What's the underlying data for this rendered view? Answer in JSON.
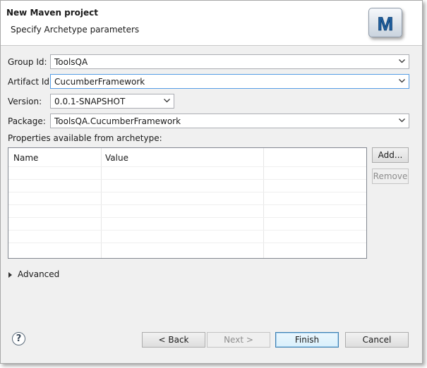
{
  "banner": {
    "title": "New Maven project",
    "subtitle": "Specify Archetype parameters",
    "logo_letter": "M"
  },
  "form": {
    "group_id_label": "Group Id:",
    "group_id_value": "ToolsQA",
    "artifact_id_label": "Artifact Id:",
    "artifact_id_value": "CucumberFramework",
    "version_label": "Version:",
    "version_value": "0.0.1-SNAPSHOT",
    "package_label": "Package:",
    "package_value": "ToolsQA.CucumberFramework"
  },
  "properties": {
    "label": "Properties available from archetype:",
    "columns": [
      "Name",
      "Value"
    ],
    "rows": []
  },
  "side_buttons": {
    "add_label": "Add...",
    "remove_label": "Remove"
  },
  "advanced": {
    "label": "Advanced"
  },
  "footer": {
    "help": "?",
    "back_label": "< Back",
    "next_label": "Next >",
    "finish_label": "Finish",
    "cancel_label": "Cancel"
  },
  "colors": {
    "focus_border": "#569de5",
    "dialog_bg": "#f0f0f0"
  }
}
